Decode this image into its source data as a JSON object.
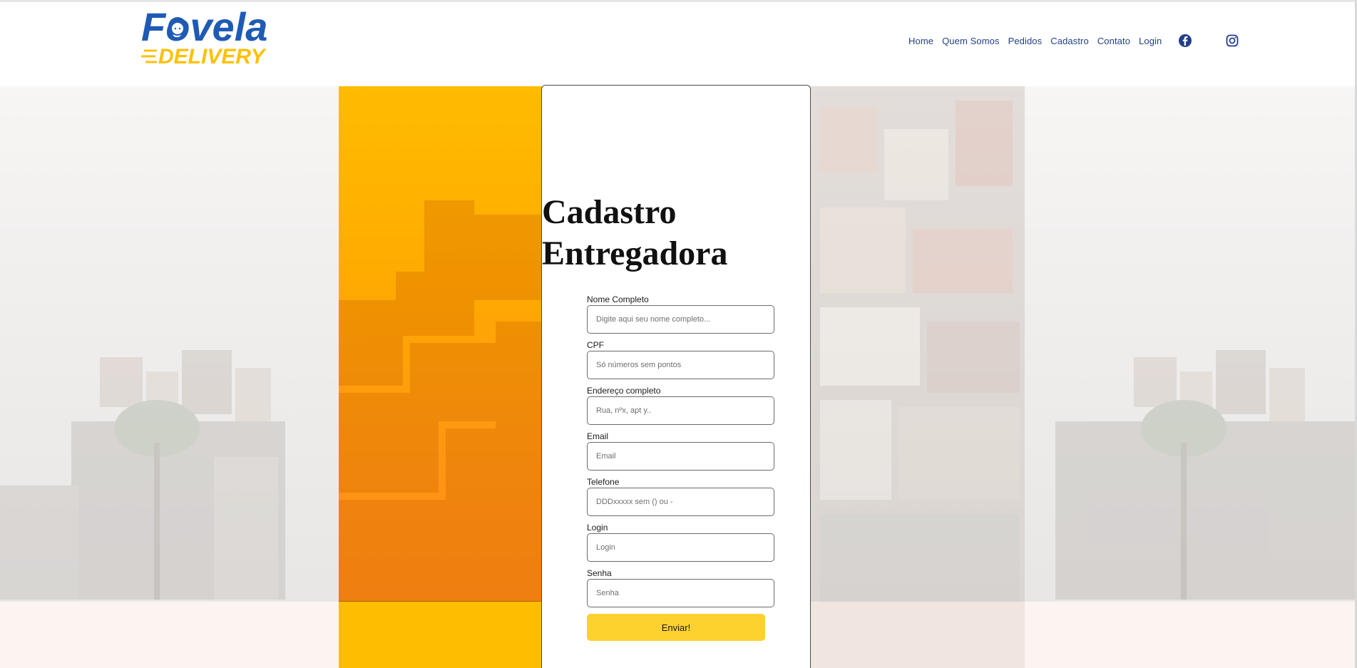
{
  "brand": {
    "logo_word_top": "Fovela",
    "logo_word_bottom": "DELIVERY",
    "colors": {
      "blue": "#1f5bb4",
      "yellow": "#ffc107",
      "nav": "#223f8a"
    }
  },
  "nav": {
    "items": [
      {
        "label": "Home"
      },
      {
        "label": "Quem Somos"
      },
      {
        "label": "Pedidos"
      },
      {
        "label": "Cadastro"
      },
      {
        "label": "Contato"
      },
      {
        "label": "Login"
      }
    ],
    "social": [
      "facebook-icon",
      "instagram-icon"
    ]
  },
  "form": {
    "title_line1": "Cadastro",
    "title_line2": "Entregadora",
    "fields": [
      {
        "label": "Nome Completo",
        "placeholder": "Digite aqui seu nome completo..."
      },
      {
        "label": "CPF",
        "placeholder": "Só números sem pontos"
      },
      {
        "label": "Endereço completo",
        "placeholder": "Rua, nºx, apt y.."
      },
      {
        "label": "Email",
        "placeholder": "Email"
      },
      {
        "label": "Telefone",
        "placeholder": "DDDxxxxx sem () ou -"
      },
      {
        "label": "Login",
        "placeholder": "Login"
      },
      {
        "label": "Senha",
        "placeholder": "Senha"
      }
    ],
    "submit_label": "Enviar!"
  }
}
